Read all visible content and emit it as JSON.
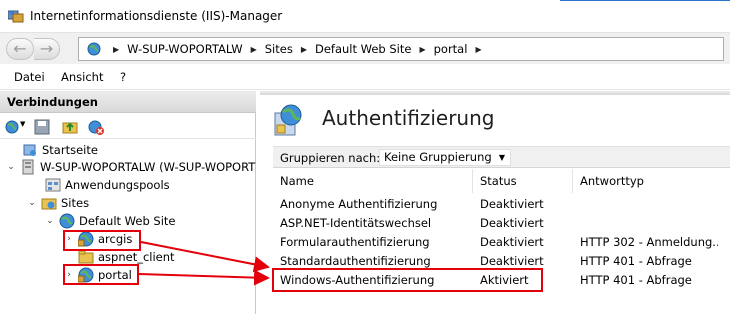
{
  "window": {
    "title": "Internetinformationsdienste (IIS)-Manager"
  },
  "address": {
    "crumbs": [
      "W-SUP-WOPORTALW",
      "Sites",
      "Default Web Site",
      "portal"
    ]
  },
  "menu": {
    "items": [
      "Datei",
      "Ansicht",
      "?"
    ]
  },
  "connections": {
    "title": "Verbindungen",
    "tree": [
      {
        "label": "Startseite",
        "icon": "start-page-icon"
      },
      {
        "label": "W-SUP-WOPORTALW (W-SUP-WOPORT",
        "icon": "server-icon",
        "toggle": "⌄"
      },
      {
        "label": "Anwendungspools",
        "icon": "app-pools-icon"
      },
      {
        "label": "Sites",
        "icon": "sites-folder-icon",
        "toggle": "⌄"
      },
      {
        "label": "Default Web Site",
        "icon": "globe-icon",
        "toggle": "⌄"
      },
      {
        "label": "arcgis",
        "icon": "application-globe-icon",
        "toggle": "›"
      },
      {
        "label": "aspnet_client",
        "icon": "folder-icon"
      },
      {
        "label": "portal",
        "icon": "application-globe-icon",
        "toggle": "›"
      }
    ]
  },
  "feature": {
    "title": "Authentifizierung",
    "group_label": "Gruppieren nach:",
    "group_value": "Keine Gruppierung",
    "columns": [
      "Name",
      "Status",
      "Antworttyp"
    ],
    "rows": [
      {
        "name": "Anonyme Authentifizierung",
        "status": "Deaktiviert",
        "response": ""
      },
      {
        "name": "ASP.NET-Identitätswechsel",
        "status": "Deaktiviert",
        "response": ""
      },
      {
        "name": "Formularauthentifizierung",
        "status": "Deaktiviert",
        "response": "HTTP 302 - Anmeldung..."
      },
      {
        "name": "Standardauthentifizierung",
        "status": "Deaktiviert",
        "response": "HTTP 401 - Abfrage"
      },
      {
        "name": "Windows-Authentifizierung",
        "status": "Aktiviert",
        "response": "HTTP 401 - Abfrage"
      }
    ]
  },
  "colors": {
    "annotation_red": "#e3000b",
    "accent_blue": "#2b73c9"
  }
}
